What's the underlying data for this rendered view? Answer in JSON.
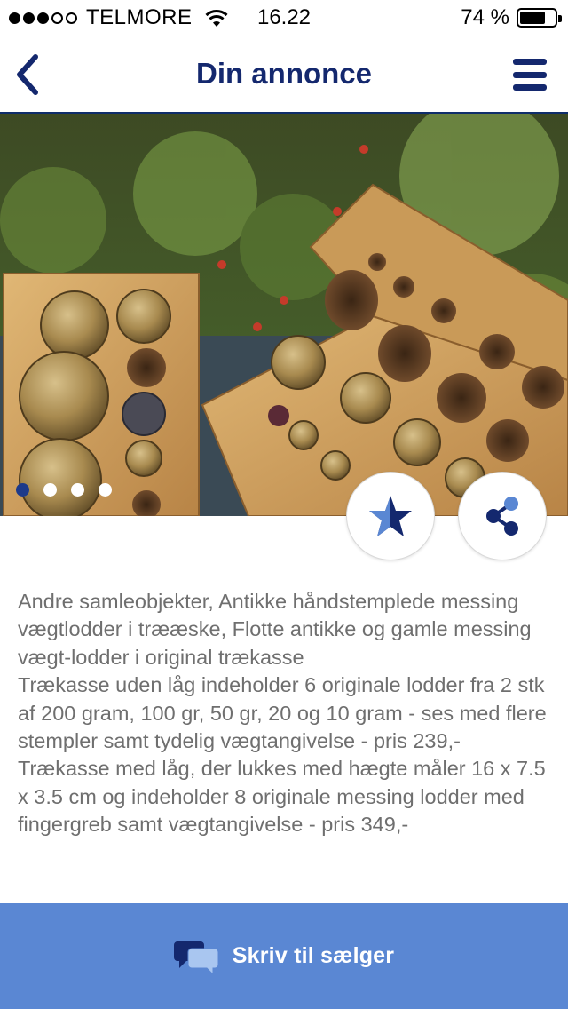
{
  "status_bar": {
    "carrier": "TELMORE",
    "time": "16.22",
    "battery": "74 %",
    "battery_level": 0.74,
    "signal_bars": 3,
    "signal_total": 5
  },
  "nav": {
    "title": "Din annonce",
    "back_icon": "chevron-left-icon",
    "menu_icon": "hamburger-menu-icon"
  },
  "gallery": {
    "image_count": 4,
    "active_index": 0,
    "favorite_icon": "star-icon",
    "share_icon": "share-icon"
  },
  "description": {
    "lines": [
      "Andre samleobjekter, Antikke håndstemplede messing vægtlodder i trææske, Flotte antikke og gamle messing vægt-lodder i original trækasse",
      "Trækasse uden låg indeholder 6 originale lodder fra 2 stk af 200 gram, 100 gr, 50 gr, 20 og 10 gram - ses med flere stempler samt tydelig vægtangivelse - pris 239,-",
      "Trækasse med låg, der lukkes med hægte måler 16 x 7.5 x 3.5 cm og indeholder 8 originale messing lodder med fingergreb samt vægtangivelse - pris 349,-"
    ]
  },
  "cta": {
    "label": "Skriv til sælger",
    "icon": "chat-bubbles-icon"
  },
  "colors": {
    "brand_navy": "#14286e",
    "cta_blue": "#5a87d3",
    "text_gray": "#6f6f6f"
  }
}
